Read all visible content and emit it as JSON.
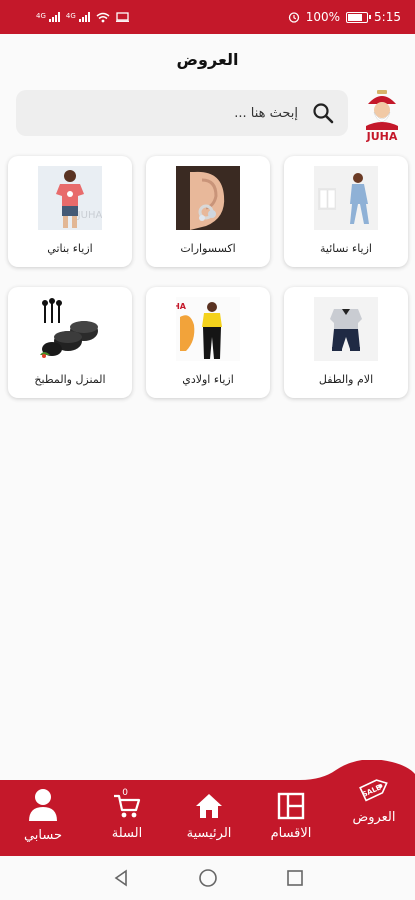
{
  "status_bar": {
    "battery": "100%",
    "time": "5:15",
    "sim1": "4G",
    "sim2": "4G"
  },
  "header": {
    "title": "العروض"
  },
  "search": {
    "placeholder": "إبحث هنا ..."
  },
  "logo": {
    "text": "JUHA"
  },
  "categories": [
    {
      "label": "ازياء نسائية",
      "image": "women-fashion"
    },
    {
      "label": "اكسسوارات",
      "image": "earring"
    },
    {
      "label": "ازياء بناتي",
      "image": "girl-tshirt"
    },
    {
      "label": "الام والطفل",
      "image": "baby-outfit"
    },
    {
      "label": "ازياء اولادي",
      "image": "kids-outfit"
    },
    {
      "label": "المنزل والمطبخ",
      "image": "cookware-set"
    }
  ],
  "bottom_nav": {
    "items": [
      {
        "label": "العروض",
        "icon": "sale-tag-icon",
        "active": true
      },
      {
        "label": "الاقسام",
        "icon": "sections-icon"
      },
      {
        "label": "الرئيسية",
        "icon": "home-icon"
      },
      {
        "label": "السلة",
        "icon": "cart-icon",
        "count": "0"
      },
      {
        "label": "حسابي",
        "icon": "account-icon"
      }
    ]
  },
  "colors": {
    "brand": "#c4182a",
    "background": "#fafafa",
    "search_bg": "#eeeeee"
  }
}
